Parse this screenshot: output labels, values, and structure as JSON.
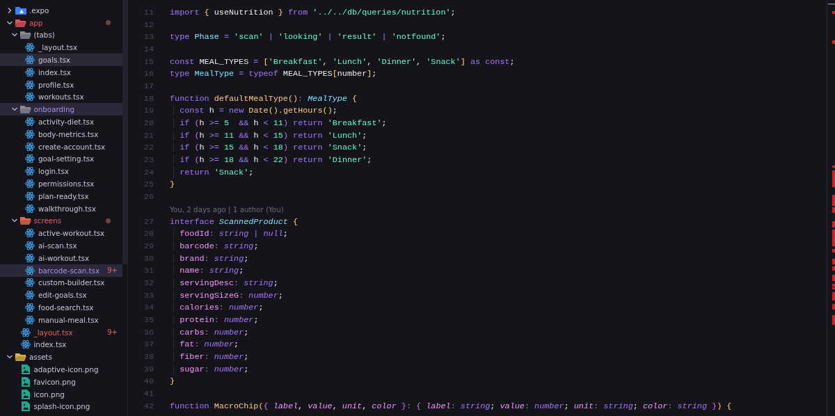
{
  "explorer": {
    "items": [
      {
        "kind": "expo-folder",
        "label": ".expo",
        "color": "#3b82f6",
        "expanded": false,
        "selected": false,
        "hovered": false,
        "error": false
      },
      {
        "kind": "folder",
        "label": "app",
        "color": "#e0525a",
        "expanded": true,
        "selected": false,
        "hovered": false,
        "error": true,
        "dot": true,
        "children": [
          {
            "kind": "folder",
            "label": "(tabs)",
            "color": "#8d8b99",
            "expanded": true,
            "selected": false,
            "hovered": false,
            "error": false,
            "children": [
              {
                "kind": "react-file",
                "label": "_layout.tsx",
                "selected": false,
                "hovered": false,
                "error": false
              },
              {
                "kind": "react-file",
                "label": "goals.tsx",
                "selected": false,
                "hovered": true,
                "error": false
              },
              {
                "kind": "react-file",
                "label": "index.tsx",
                "selected": false,
                "hovered": false,
                "error": false
              },
              {
                "kind": "react-file",
                "label": "profile.tsx",
                "selected": false,
                "hovered": false,
                "error": false
              },
              {
                "kind": "react-file",
                "label": "workouts.tsx",
                "selected": false,
                "hovered": false,
                "error": false
              }
            ]
          },
          {
            "kind": "folder",
            "label": "onboarding",
            "color": "#8d8b99",
            "expanded": true,
            "selected": true,
            "hovered": false,
            "error": false,
            "children": [
              {
                "kind": "react-file",
                "label": "activity-diet.tsx",
                "selected": false,
                "hovered": false,
                "error": false
              },
              {
                "kind": "react-file",
                "label": "body-metrics.tsx",
                "selected": false,
                "hovered": false,
                "error": false
              },
              {
                "kind": "react-file",
                "label": "create-account.tsx",
                "selected": false,
                "hovered": false,
                "error": false
              },
              {
                "kind": "react-file",
                "label": "goal-setting.tsx",
                "selected": false,
                "hovered": false,
                "error": false
              },
              {
                "kind": "react-file",
                "label": "login.tsx",
                "selected": false,
                "hovered": false,
                "error": false
              },
              {
                "kind": "react-file",
                "label": "permissions.tsx",
                "selected": false,
                "hovered": false,
                "error": false
              },
              {
                "kind": "react-file",
                "label": "plan-ready.tsx",
                "selected": false,
                "hovered": false,
                "error": false
              },
              {
                "kind": "react-file",
                "label": "walkthrough.tsx",
                "selected": false,
                "hovered": false,
                "error": false
              }
            ]
          },
          {
            "kind": "folder",
            "label": "screens",
            "color": "#e8684f",
            "expanded": true,
            "selected": false,
            "hovered": false,
            "error": true,
            "dot": true,
            "children": [
              {
                "kind": "react-file",
                "label": "active-workout.tsx",
                "selected": false,
                "hovered": false,
                "error": false
              },
              {
                "kind": "react-file",
                "label": "ai-scan.tsx",
                "selected": false,
                "hovered": false,
                "error": false
              },
              {
                "kind": "react-file",
                "label": "ai-workout.tsx",
                "selected": false,
                "hovered": false,
                "error": false
              },
              {
                "kind": "react-file",
                "label": "barcode-scan.tsx",
                "selected": true,
                "hovered": false,
                "error": false,
                "badge": "9+"
              },
              {
                "kind": "react-file",
                "label": "custom-builder.tsx",
                "selected": false,
                "hovered": false,
                "error": false
              },
              {
                "kind": "react-file",
                "label": "edit-goals.tsx",
                "selected": false,
                "hovered": false,
                "error": false
              },
              {
                "kind": "react-file",
                "label": "food-search.tsx",
                "selected": false,
                "hovered": false,
                "error": false
              },
              {
                "kind": "react-file",
                "label": "manual-meal.tsx",
                "selected": false,
                "hovered": false,
                "error": false
              }
            ]
          },
          {
            "kind": "react-file",
            "label": "_layout.tsx",
            "selected": false,
            "hovered": false,
            "error": true,
            "badge": "9+"
          },
          {
            "kind": "react-file",
            "label": "index.tsx",
            "selected": false,
            "hovered": false,
            "error": false
          }
        ]
      },
      {
        "kind": "folder",
        "label": "assets",
        "color": "#e2b53c",
        "expanded": true,
        "selected": false,
        "hovered": false,
        "error": false,
        "children": [
          {
            "kind": "image-file",
            "label": "adaptive-icon.png",
            "selected": false,
            "hovered": false,
            "error": false
          },
          {
            "kind": "image-file",
            "label": "favicon.png",
            "selected": false,
            "hovered": false,
            "error": false
          },
          {
            "kind": "image-file",
            "label": "icon.png",
            "selected": false,
            "hovered": false,
            "error": false
          },
          {
            "kind": "image-file",
            "label": "splash-icon.png",
            "selected": false,
            "hovered": false,
            "error": false
          }
        ]
      }
    ]
  },
  "editor": {
    "lines": [
      {
        "kind": "code",
        "number": "11",
        "tokens": [
          {
            "text": "import ",
            "kind": "keyword"
          },
          {
            "text": "{",
            "kind": "brace"
          },
          {
            "text": " useNutrition ",
            "kind": "plain"
          },
          {
            "text": "}",
            "kind": "brace"
          },
          {
            "text": " from ",
            "kind": "keyword"
          },
          {
            "text": "'../../db/queries/nutrition'",
            "kind": "string"
          },
          {
            "text": ";",
            "kind": "plain"
          }
        ]
      },
      {
        "kind": "code",
        "number": "12"
      },
      {
        "kind": "code",
        "number": "13",
        "tokens": [
          {
            "text": "type ",
            "kind": "keyword"
          },
          {
            "text": "Phase",
            "kind": "type"
          },
          {
            "text": " = ",
            "kind": "operator"
          },
          {
            "text": "'scan'",
            "kind": "string"
          },
          {
            "text": " | ",
            "kind": "operator"
          },
          {
            "text": "'looking'",
            "kind": "string"
          },
          {
            "text": " | ",
            "kind": "operator"
          },
          {
            "text": "'result'",
            "kind": "string"
          },
          {
            "text": " | ",
            "kind": "operator"
          },
          {
            "text": "'notfound'",
            "kind": "string"
          },
          {
            "text": ";",
            "kind": "plain"
          }
        ]
      },
      {
        "kind": "code",
        "number": "14"
      },
      {
        "kind": "code",
        "number": "15",
        "tokens": [
          {
            "text": "const ",
            "kind": "keyword"
          },
          {
            "text": "MEAL_TYPES ",
            "kind": "plain"
          },
          {
            "text": "= ",
            "kind": "operator"
          },
          {
            "text": "[",
            "kind": "brace"
          },
          {
            "text": "'Breakfast'",
            "kind": "string"
          },
          {
            "text": ", ",
            "kind": "plain"
          },
          {
            "text": "'Lunch'",
            "kind": "string"
          },
          {
            "text": ", ",
            "kind": "plain"
          },
          {
            "text": "'Dinner'",
            "kind": "string"
          },
          {
            "text": ", ",
            "kind": "plain"
          },
          {
            "text": "'Snack'",
            "kind": "string"
          },
          {
            "text": "]",
            "kind": "brace"
          },
          {
            "text": " as const",
            "kind": "keyword"
          },
          {
            "text": ";",
            "kind": "plain"
          }
        ]
      },
      {
        "kind": "code",
        "number": "16",
        "tokens": [
          {
            "text": "type ",
            "kind": "keyword"
          },
          {
            "text": "MealType",
            "kind": "type"
          },
          {
            "text": " = ",
            "kind": "operator"
          },
          {
            "text": "typeof ",
            "kind": "keyword"
          },
          {
            "text": "MEAL_TYPES",
            "kind": "plain"
          },
          {
            "text": "[",
            "kind": "brace"
          },
          {
            "text": "number",
            "kind": "plain"
          },
          {
            "text": "]",
            "kind": "brace"
          },
          {
            "text": ";",
            "kind": "plain"
          }
        ]
      },
      {
        "kind": "code",
        "number": "17"
      },
      {
        "kind": "code",
        "number": "18",
        "tokens": [
          {
            "text": "function ",
            "kind": "keyword"
          },
          {
            "text": "defaultMealType",
            "kind": "function"
          },
          {
            "text": "()",
            "kind": "function"
          },
          {
            "text": ": ",
            "kind": "colon"
          },
          {
            "text": "MealType",
            "kind": "type-ref"
          },
          {
            "text": " {",
            "kind": "brace"
          }
        ]
      },
      {
        "kind": "code",
        "number": "19",
        "guide": true,
        "tokens": [
          {
            "text": "  const ",
            "kind": "keyword"
          },
          {
            "text": "h ",
            "kind": "plain"
          },
          {
            "text": "= ",
            "kind": "operator"
          },
          {
            "text": "new ",
            "kind": "keyword"
          },
          {
            "text": "Date",
            "kind": "function"
          },
          {
            "text": "()",
            "kind": "brace"
          },
          {
            "text": ".",
            "kind": "plain"
          },
          {
            "text": "getHours",
            "kind": "function"
          },
          {
            "text": "()",
            "kind": "brace"
          },
          {
            "text": ";",
            "kind": "plain"
          }
        ]
      },
      {
        "kind": "code",
        "number": "20",
        "guide": true,
        "tokens": [
          {
            "text": "  if ",
            "kind": "keyword"
          },
          {
            "text": "(",
            "kind": "paren"
          },
          {
            "text": "h ",
            "kind": "plain"
          },
          {
            "text": ">= ",
            "kind": "operator"
          },
          {
            "text": "5",
            "kind": "number"
          },
          {
            "text": "  && ",
            "kind": "operator"
          },
          {
            "text": "h ",
            "kind": "plain"
          },
          {
            "text": "< ",
            "kind": "operator"
          },
          {
            "text": "11",
            "kind": "number"
          },
          {
            "text": ")",
            "kind": "paren"
          },
          {
            "text": " return ",
            "kind": "keyword"
          },
          {
            "text": "'Breakfast'",
            "kind": "string"
          },
          {
            "text": ";",
            "kind": "plain"
          }
        ]
      },
      {
        "kind": "code",
        "number": "21",
        "guide": true,
        "tokens": [
          {
            "text": "  if ",
            "kind": "keyword"
          },
          {
            "text": "(",
            "kind": "paren"
          },
          {
            "text": "h ",
            "kind": "plain"
          },
          {
            "text": ">= ",
            "kind": "operator"
          },
          {
            "text": "11",
            "kind": "number"
          },
          {
            "text": " && ",
            "kind": "operator"
          },
          {
            "text": "h ",
            "kind": "plain"
          },
          {
            "text": "< ",
            "kind": "operator"
          },
          {
            "text": "15",
            "kind": "number"
          },
          {
            "text": ")",
            "kind": "paren"
          },
          {
            "text": " return ",
            "kind": "keyword"
          },
          {
            "text": "'Lunch'",
            "kind": "string"
          },
          {
            "text": ";",
            "kind": "plain"
          }
        ]
      },
      {
        "kind": "code",
        "number": "22",
        "guide": true,
        "tokens": [
          {
            "text": "  if ",
            "kind": "keyword"
          },
          {
            "text": "(",
            "kind": "paren"
          },
          {
            "text": "h ",
            "kind": "plain"
          },
          {
            "text": ">= ",
            "kind": "operator"
          },
          {
            "text": "15",
            "kind": "number"
          },
          {
            "text": " && ",
            "kind": "operator"
          },
          {
            "text": "h ",
            "kind": "plain"
          },
          {
            "text": "< ",
            "kind": "operator"
          },
          {
            "text": "18",
            "kind": "number"
          },
          {
            "text": ")",
            "kind": "paren"
          },
          {
            "text": " return ",
            "kind": "keyword"
          },
          {
            "text": "'Snack'",
            "kind": "string"
          },
          {
            "text": ";",
            "kind": "plain"
          }
        ]
      },
      {
        "kind": "code",
        "number": "23",
        "guide": true,
        "tokens": [
          {
            "text": "  if ",
            "kind": "keyword"
          },
          {
            "text": "(",
            "kind": "paren"
          },
          {
            "text": "h ",
            "kind": "plain"
          },
          {
            "text": ">= ",
            "kind": "operator"
          },
          {
            "text": "18",
            "kind": "number"
          },
          {
            "text": " && ",
            "kind": "operator"
          },
          {
            "text": "h ",
            "kind": "plain"
          },
          {
            "text": "< ",
            "kind": "operator"
          },
          {
            "text": "22",
            "kind": "number"
          },
          {
            "text": ")",
            "kind": "paren"
          },
          {
            "text": " return ",
            "kind": "keyword"
          },
          {
            "text": "'Dinner'",
            "kind": "string"
          },
          {
            "text": ";",
            "kind": "plain"
          }
        ]
      },
      {
        "kind": "code",
        "number": "24",
        "guide": true,
        "tokens": [
          {
            "text": "  return ",
            "kind": "keyword"
          },
          {
            "text": "'Snack'",
            "kind": "string"
          },
          {
            "text": ";",
            "kind": "plain"
          }
        ]
      },
      {
        "kind": "code",
        "number": "25",
        "tokens": [
          {
            "text": "}",
            "kind": "brace"
          }
        ]
      },
      {
        "kind": "code",
        "number": "26"
      },
      {
        "kind": "codelens",
        "text": "You, 2 days ago | 1 author (You)"
      },
      {
        "kind": "code",
        "number": "27",
        "tokens": [
          {
            "text": "interface ",
            "kind": "keyword"
          },
          {
            "text": "ScannedProduct",
            "kind": "type-ref"
          },
          {
            "text": " {",
            "kind": "brace"
          }
        ]
      },
      {
        "kind": "code",
        "number": "28",
        "guide": true,
        "tokens": [
          {
            "text": "  foodId",
            "kind": "property"
          },
          {
            "text": ": ",
            "kind": "colon"
          },
          {
            "text": "string | null",
            "kind": "annotation"
          },
          {
            "text": ";",
            "kind": "plain"
          }
        ]
      },
      {
        "kind": "code",
        "number": "29",
        "guide": true,
        "tokens": [
          {
            "text": "  barcode",
            "kind": "property"
          },
          {
            "text": ": ",
            "kind": "colon"
          },
          {
            "text": "string",
            "kind": "annotation"
          },
          {
            "text": ";",
            "kind": "plain"
          }
        ]
      },
      {
        "kind": "code",
        "number": "30",
        "guide": true,
        "tokens": [
          {
            "text": "  brand",
            "kind": "property"
          },
          {
            "text": ": ",
            "kind": "colon"
          },
          {
            "text": "string",
            "kind": "annotation"
          },
          {
            "text": ";",
            "kind": "plain"
          }
        ]
      },
      {
        "kind": "code",
        "number": "31",
        "guide": true,
        "tokens": [
          {
            "text": "  name",
            "kind": "property"
          },
          {
            "text": ": ",
            "kind": "colon"
          },
          {
            "text": "string",
            "kind": "annotation"
          },
          {
            "text": ";",
            "kind": "plain"
          }
        ]
      },
      {
        "kind": "code",
        "number": "32",
        "guide": true,
        "tokens": [
          {
            "text": "  servingDesc",
            "kind": "property"
          },
          {
            "text": ": ",
            "kind": "colon"
          },
          {
            "text": "string",
            "kind": "annotation"
          },
          {
            "text": ";",
            "kind": "plain"
          }
        ]
      },
      {
        "kind": "code",
        "number": "33",
        "guide": true,
        "tokens": [
          {
            "text": "  servingSizeG",
            "kind": "property"
          },
          {
            "text": ": ",
            "kind": "colon"
          },
          {
            "text": "number",
            "kind": "annotation"
          },
          {
            "text": ";",
            "kind": "plain"
          }
        ]
      },
      {
        "kind": "code",
        "number": "34",
        "guide": true,
        "tokens": [
          {
            "text": "  calories",
            "kind": "property"
          },
          {
            "text": ": ",
            "kind": "colon"
          },
          {
            "text": "number",
            "kind": "annotation"
          },
          {
            "text": ";",
            "kind": "plain"
          }
        ]
      },
      {
        "kind": "code",
        "number": "35",
        "guide": true,
        "tokens": [
          {
            "text": "  protein",
            "kind": "property"
          },
          {
            "text": ": ",
            "kind": "colon"
          },
          {
            "text": "number",
            "kind": "annotation"
          },
          {
            "text": ";",
            "kind": "plain"
          }
        ]
      },
      {
        "kind": "code",
        "number": "36",
        "guide": true,
        "tokens": [
          {
            "text": "  carbs",
            "kind": "property"
          },
          {
            "text": ": ",
            "kind": "colon"
          },
          {
            "text": "number",
            "kind": "annotation"
          },
          {
            "text": ";",
            "kind": "plain"
          }
        ]
      },
      {
        "kind": "code",
        "number": "37",
        "guide": true,
        "tokens": [
          {
            "text": "  fat",
            "kind": "property"
          },
          {
            "text": ": ",
            "kind": "colon"
          },
          {
            "text": "number",
            "kind": "annotation"
          },
          {
            "text": ";",
            "kind": "plain"
          }
        ]
      },
      {
        "kind": "code",
        "number": "38",
        "guide": true,
        "tokens": [
          {
            "text": "  fiber",
            "kind": "property"
          },
          {
            "text": ": ",
            "kind": "colon"
          },
          {
            "text": "number",
            "kind": "annotation"
          },
          {
            "text": ";",
            "kind": "plain"
          }
        ]
      },
      {
        "kind": "code",
        "number": "39",
        "guide": true,
        "tokens": [
          {
            "text": "  sugar",
            "kind": "property"
          },
          {
            "text": ": ",
            "kind": "colon"
          },
          {
            "text": "number",
            "kind": "annotation"
          },
          {
            "text": ";",
            "kind": "plain"
          }
        ]
      },
      {
        "kind": "code",
        "number": "40",
        "tokens": [
          {
            "text": "}",
            "kind": "brace"
          }
        ]
      },
      {
        "kind": "code",
        "number": "41"
      },
      {
        "kind": "code",
        "number": "42",
        "tokens": [
          {
            "text": "function ",
            "kind": "keyword"
          },
          {
            "text": "MacroChip",
            "kind": "function"
          },
          {
            "text": "(",
            "kind": "brace"
          },
          {
            "text": "{ ",
            "kind": "paren"
          },
          {
            "text": "label",
            "kind": "param"
          },
          {
            "text": ", ",
            "kind": "plain"
          },
          {
            "text": "value",
            "kind": "param"
          },
          {
            "text": ", ",
            "kind": "plain"
          },
          {
            "text": "unit",
            "kind": "param"
          },
          {
            "text": ", ",
            "kind": "plain"
          },
          {
            "text": "color",
            "kind": "param"
          },
          {
            "text": " }",
            "kind": "paren"
          },
          {
            "text": ": ",
            "kind": "colon"
          },
          {
            "text": "{ ",
            "kind": "paren"
          },
          {
            "text": "label",
            "kind": "param"
          },
          {
            "text": ": ",
            "kind": "colon"
          },
          {
            "text": "string",
            "kind": "annotation"
          },
          {
            "text": "; ",
            "kind": "plain"
          },
          {
            "text": "value",
            "kind": "param"
          },
          {
            "text": ": ",
            "kind": "colon"
          },
          {
            "text": "number",
            "kind": "annotation"
          },
          {
            "text": "; ",
            "kind": "plain"
          },
          {
            "text": "unit",
            "kind": "param"
          },
          {
            "text": ": ",
            "kind": "colon"
          },
          {
            "text": "string",
            "kind": "annotation"
          },
          {
            "text": "; ",
            "kind": "plain"
          },
          {
            "text": "color",
            "kind": "param"
          },
          {
            "text": ": ",
            "kind": "colon"
          },
          {
            "text": "string",
            "kind": "annotation"
          },
          {
            "text": " }",
            "kind": "paren"
          },
          {
            "text": ")",
            "kind": "brace"
          },
          {
            "text": " {",
            "kind": "brace"
          }
        ]
      }
    ]
  }
}
